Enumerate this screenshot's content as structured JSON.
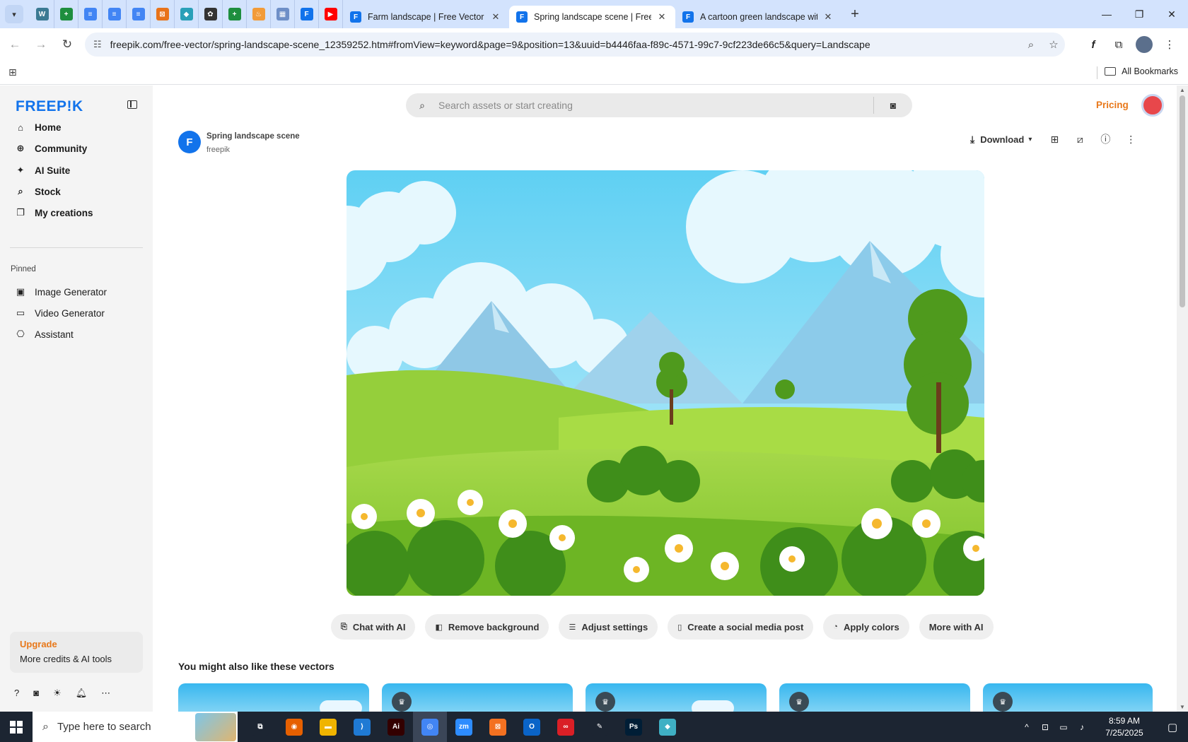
{
  "browser": {
    "pinned_tabs": [
      {
        "icon": "wordpress-icon",
        "color": "#3b7a93",
        "glyph": "W"
      },
      {
        "icon": "sheets-icon",
        "color": "#1e8e3e",
        "glyph": "+"
      },
      {
        "icon": "docs-icon",
        "color": "#4285f4",
        "glyph": "≡"
      },
      {
        "icon": "docs-icon",
        "color": "#4285f4",
        "glyph": "≡"
      },
      {
        "icon": "docs-icon",
        "color": "#4285f4",
        "glyph": "≡"
      },
      {
        "icon": "xampp-icon",
        "color": "#e8731a",
        "glyph": "⊠"
      },
      {
        "icon": "app-icon",
        "color": "#2aa0b8",
        "glyph": "◆"
      },
      {
        "icon": "openai-icon",
        "color": "#333333",
        "glyph": "✿"
      },
      {
        "icon": "sheets-icon",
        "color": "#1e8e3e",
        "glyph": "+"
      },
      {
        "icon": "flame-icon",
        "color": "#f29b38",
        "glyph": "♨"
      },
      {
        "icon": "app-icon",
        "color": "#6e8fc7",
        "glyph": "▦"
      },
      {
        "icon": "freepik-icon",
        "color": "#1273eb",
        "glyph": "F"
      },
      {
        "icon": "youtube-icon",
        "color": "#ff0000",
        "glyph": "▶"
      }
    ],
    "tabs": [
      {
        "title": "Farm landscape | Free Vector",
        "active": false
      },
      {
        "title": "Spring landscape scene | Free V",
        "active": true
      },
      {
        "title": "A cartoon green landscape with",
        "active": false
      }
    ],
    "url": "freepik.com/free-vector/spring-landscape-scene_12359252.htm#fromView=keyword&page=9&position=13&uuid=b4446faa-f89c-4571-99c7-9cf223de66c5&query=Landscape",
    "all_bookmarks_label": "All Bookmarks"
  },
  "sidebar": {
    "logo": "FREEP!K",
    "nav": [
      {
        "label": "Home",
        "icon": "home-icon",
        "glyph": "⌂"
      },
      {
        "label": "Community",
        "icon": "globe-icon",
        "glyph": "⊕"
      },
      {
        "label": "AI Suite",
        "icon": "sparkle-icon",
        "glyph": "✦"
      },
      {
        "label": "Stock",
        "icon": "search-icon",
        "glyph": "⌕"
      },
      {
        "label": "My creations",
        "icon": "creations-icon",
        "glyph": "❐"
      }
    ],
    "pinned_label": "Pinned",
    "pinned": [
      {
        "label": "Image Generator",
        "icon": "image-icon",
        "glyph": "▣"
      },
      {
        "label": "Video Generator",
        "icon": "video-icon",
        "glyph": "▭"
      },
      {
        "label": "Assistant",
        "icon": "assistant-icon",
        "glyph": "⎔"
      }
    ],
    "upgrade_title": "Upgrade",
    "upgrade_subtitle": "More credits & AI tools"
  },
  "header": {
    "search_placeholder": "Search assets or start creating",
    "pricing_label": "Pricing"
  },
  "asset": {
    "title": "Spring landscape scene",
    "author": "freepik",
    "download_label": "Download"
  },
  "ai_tools": [
    {
      "label": "Chat with AI",
      "icon": "chat-icon",
      "glyph": "⎘"
    },
    {
      "label": "Remove background",
      "icon": "remove-bg-icon",
      "glyph": "◧"
    },
    {
      "label": "Adjust settings",
      "icon": "sliders-icon",
      "glyph": "☰"
    },
    {
      "label": "Create a social media post",
      "icon": "phone-icon",
      "glyph": "▯"
    },
    {
      "label": "Apply colors",
      "icon": "palette-icon",
      "glyph": "◔"
    },
    {
      "label": "More with AI",
      "icon": "",
      "glyph": ""
    }
  ],
  "related_heading": "You might also like these vectors",
  "taskbar": {
    "search_placeholder": "Type here to search",
    "time": "8:59 AM",
    "date": "7/25/2025",
    "apps": [
      {
        "name": "task-view-icon",
        "color": "#1c2532",
        "glyph": "⧉"
      },
      {
        "name": "firefox-icon",
        "color": "#e66000",
        "glyph": "◉"
      },
      {
        "name": "file-explorer-icon",
        "color": "#f0b400",
        "glyph": "▬"
      },
      {
        "name": "vscode-icon",
        "color": "#1f7ad4",
        "glyph": "⟩"
      },
      {
        "name": "illustrator-icon",
        "color": "#330000",
        "glyph": "Ai"
      },
      {
        "name": "chrome-icon",
        "color": "#4285f4",
        "glyph": "◎"
      },
      {
        "name": "zoom-icon",
        "color": "#2d8cff",
        "glyph": "zm"
      },
      {
        "name": "xampp-icon",
        "color": "#f37121",
        "glyph": "⊠"
      },
      {
        "name": "outlook-icon",
        "color": "#0a64c8",
        "glyph": "O"
      },
      {
        "name": "creative-cloud-icon",
        "color": "#da1f26",
        "glyph": "∞"
      },
      {
        "name": "pen-tool-icon",
        "color": "#1c2532",
        "glyph": "✎"
      },
      {
        "name": "photoshop-icon",
        "color": "#001e36",
        "glyph": "Ps"
      },
      {
        "name": "app-icon",
        "color": "#3fb0c4",
        "glyph": "◆"
      }
    ]
  }
}
